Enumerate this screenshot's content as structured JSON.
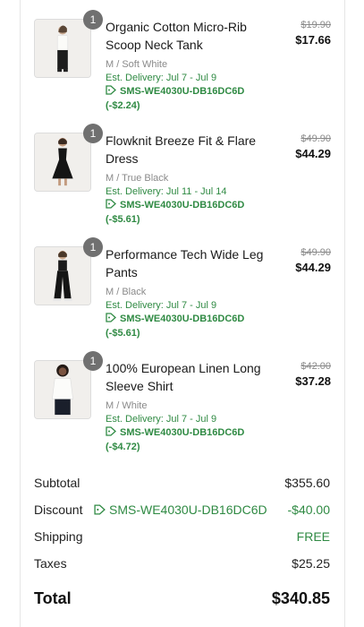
{
  "items": [
    {
      "qty": "1",
      "name": "Organic Cotton Micro-Rib Scoop Neck Tank",
      "variant": "M / Soft White",
      "delivery": "Est. Delivery: Jul 7 - Jul 9",
      "code": "SMS-WE4030U-DB16DC6D",
      "discount": "(-$2.24)",
      "original_price": "$19.90",
      "sale_price": "$17.66"
    },
    {
      "qty": "1",
      "name": "Flowknit Breeze Fit & Flare Dress",
      "variant": "M / True Black",
      "delivery": "Est. Delivery: Jul 11 - Jul 14",
      "code": "SMS-WE4030U-DB16DC6D",
      "discount": "(-$5.61)",
      "original_price": "$49.90",
      "sale_price": "$44.29"
    },
    {
      "qty": "1",
      "name": "Performance Tech Wide Leg Pants",
      "variant": "M / Black",
      "delivery": "Est. Delivery: Jul 7 - Jul 9",
      "code": "SMS-WE4030U-DB16DC6D",
      "discount": "(-$5.61)",
      "original_price": "$49.90",
      "sale_price": "$44.29"
    },
    {
      "qty": "1",
      "name": "100% European Linen Long Sleeve Shirt",
      "variant": "M / White",
      "delivery": "Est. Delivery: Jul 7 - Jul 9",
      "code": "SMS-WE4030U-DB16DC6D",
      "discount": "(-$4.72)",
      "original_price": "$42.00",
      "sale_price": "$37.28"
    }
  ],
  "summary": {
    "subtotal_label": "Subtotal",
    "subtotal_value": "$355.60",
    "discount_label": "Discount",
    "discount_code": "SMS-WE4030U-DB16DC6D",
    "discount_value": "-$40.00",
    "shipping_label": "Shipping",
    "shipping_value": "FREE",
    "taxes_label": "Taxes",
    "taxes_value": "$25.25",
    "total_label": "Total",
    "total_value": "$340.85"
  },
  "colors": {
    "accent_green": "#2f8a43",
    "qty_badge": "#707070"
  }
}
